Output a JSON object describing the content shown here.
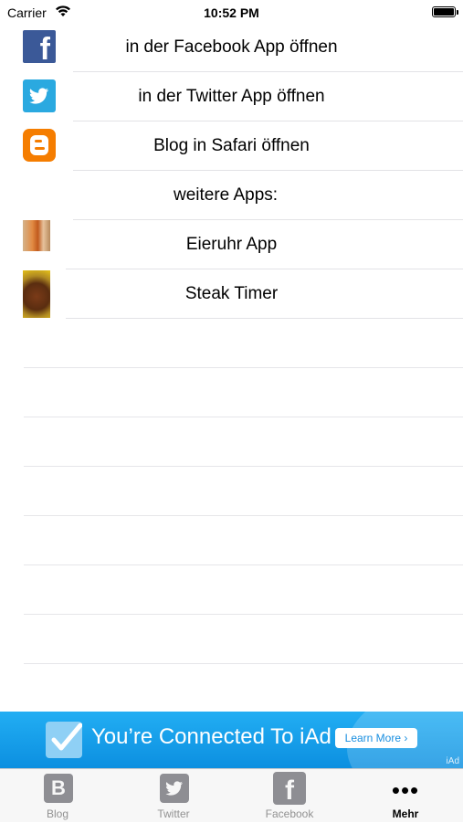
{
  "status_bar": {
    "carrier": "Carrier",
    "time": "10:52 PM"
  },
  "list": {
    "rows": [
      {
        "label": "in der Facebook App öffnen",
        "icon": "facebook-icon"
      },
      {
        "label": "in der Twitter App öffnen",
        "icon": "twitter-icon"
      },
      {
        "label": "Blog in Safari öffnen",
        "icon": "blogger-icon"
      },
      {
        "label": "weitere Apps:"
      },
      {
        "label": "Eieruhr App",
        "icon": "eieruhr-app-icon"
      },
      {
        "label": "Steak Timer",
        "icon": "steak-timer-app-icon"
      }
    ]
  },
  "ad_banner": {
    "text": "You’re Connected To iAd",
    "button_label": "Learn More ›",
    "badge": "iAd",
    "color": "#1aa3ea"
  },
  "tab_bar": {
    "tabs": [
      {
        "label": "Blog",
        "icon": "blogger-icon"
      },
      {
        "label": "Twitter",
        "icon": "twitter-icon"
      },
      {
        "label": "Facebook",
        "icon": "facebook-icon"
      },
      {
        "label": "Mehr",
        "icon": "more-dots-icon",
        "active": true
      }
    ]
  }
}
